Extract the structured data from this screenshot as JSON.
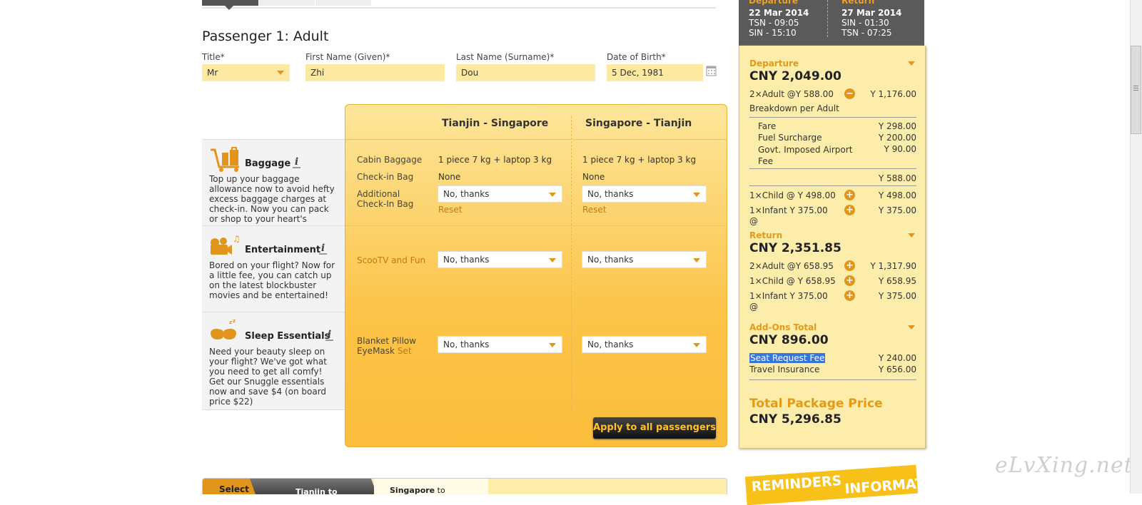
{
  "summary_top": {
    "departure_label": "Departure",
    "departure_date": "22 Mar 2014",
    "departure_from": "TSN - 09:05",
    "departure_to": "SIN - 15:10",
    "return_label": "Return",
    "return_date": "27 Mar 2014",
    "return_from": "SIN - 01:30",
    "return_to": "TSN - 07:25"
  },
  "passenger": {
    "heading": "Passenger  1: Adult",
    "title_label": "Title*",
    "title_value": "Mr",
    "first_name_label": "First Name (Given)*",
    "first_name_value": "Zhi",
    "last_name_label": "Last Name (Surname)*",
    "last_name_value": "Dou",
    "dob_label": "Date of Birth*",
    "dob_value": "5 Dec, 1981"
  },
  "addons": {
    "col1": "Tianjin - Singapore",
    "col2": "Singapore - Tianjin",
    "baggage": {
      "title": "Baggage",
      "desc": "Top up your baggage allowance now to avoid hefty excess baggage charges at check-in. Now you can pack or shop to your heart's content!",
      "cabin_label": "Cabin Baggage",
      "cabin_value1": "1 piece 7 kg + laptop 3 kg",
      "cabin_value2": "1 piece 7 kg + laptop 3 kg",
      "checkin_label": "Check-in Bag",
      "checkin_value1": "None",
      "checkin_value2": "None",
      "additional_label": "Additional Check-In Bag",
      "select1": "No, thanks",
      "select2": "No, thanks",
      "reset": "Reset"
    },
    "entertainment": {
      "title": "Entertainment",
      "desc": "Bored on your flight? Now for a little fee, you can catch up on the latest blockbuster movies and be entertained!",
      "label": "ScooTV and Fun",
      "select1": "No, thanks",
      "select2": "No, thanks"
    },
    "sleep": {
      "title": "Sleep Essentials",
      "desc": "Need your beauty sleep on your flight? We've got what you need to get all comfy! Get our Snuggle essentials now and save $4 (on board price $22)",
      "label_a": "Blanket Pillow",
      "label_b": "EyeMask",
      "label_c": "Set",
      "select1": "No, thanks",
      "select2": "No, thanks"
    },
    "apply_button": "Apply to all passengers"
  },
  "summary": {
    "departure_label": "Departure",
    "departure_total": "CNY 2,049.00",
    "dep_adult": "2×Adult @Y 588.00",
    "dep_adult_amt": "Y 1,176.00",
    "breakdown_label": "Breakdown per Adult",
    "fare_label": "Fare",
    "fare_amt": "Y 298.00",
    "fuel_label": "Fuel Surcharge",
    "fuel_amt": "Y 200.00",
    "govt_label": "Govt. Imposed Airport Fee",
    "govt_amt": "Y 90.00",
    "subtotal_amt": "Y 588.00",
    "dep_child": "1×Child @ Y 498.00",
    "dep_child_amt": "Y 498.00",
    "dep_infant": "1×Infant   Y 375.00 @",
    "dep_infant_amt": "Y 375.00",
    "return_label": "Return",
    "return_total": "CNY 2,351.85",
    "ret_adult": "2×Adult @Y 658.95",
    "ret_adult_amt": "Y 1,317.90",
    "ret_child": "1×Child @ Y 658.95",
    "ret_child_amt": "Y 658.95",
    "ret_infant": "1×Infant   Y 375.00 @",
    "ret_infant_amt": "Y 375.00",
    "addons_label": "Add-Ons Total",
    "addons_total": "CNY 896.00",
    "seat_label": "Seat Request Fee",
    "seat_amt": "Y 240.00",
    "insurance_label": "Travel Insurance",
    "insurance_amt": "Y 656.00",
    "package_label": "Total Package Price",
    "package_total": "CNY 5,296.85"
  },
  "bottom": {
    "select_tab": "Select",
    "tab_a": "Tianjin to",
    "tab_b": "Singapore",
    "tab_b_suffix": "to",
    "reminders": "REMINDERS",
    "reminders_2": "INFORMATION"
  },
  "watermark": "eLvXing.net"
}
